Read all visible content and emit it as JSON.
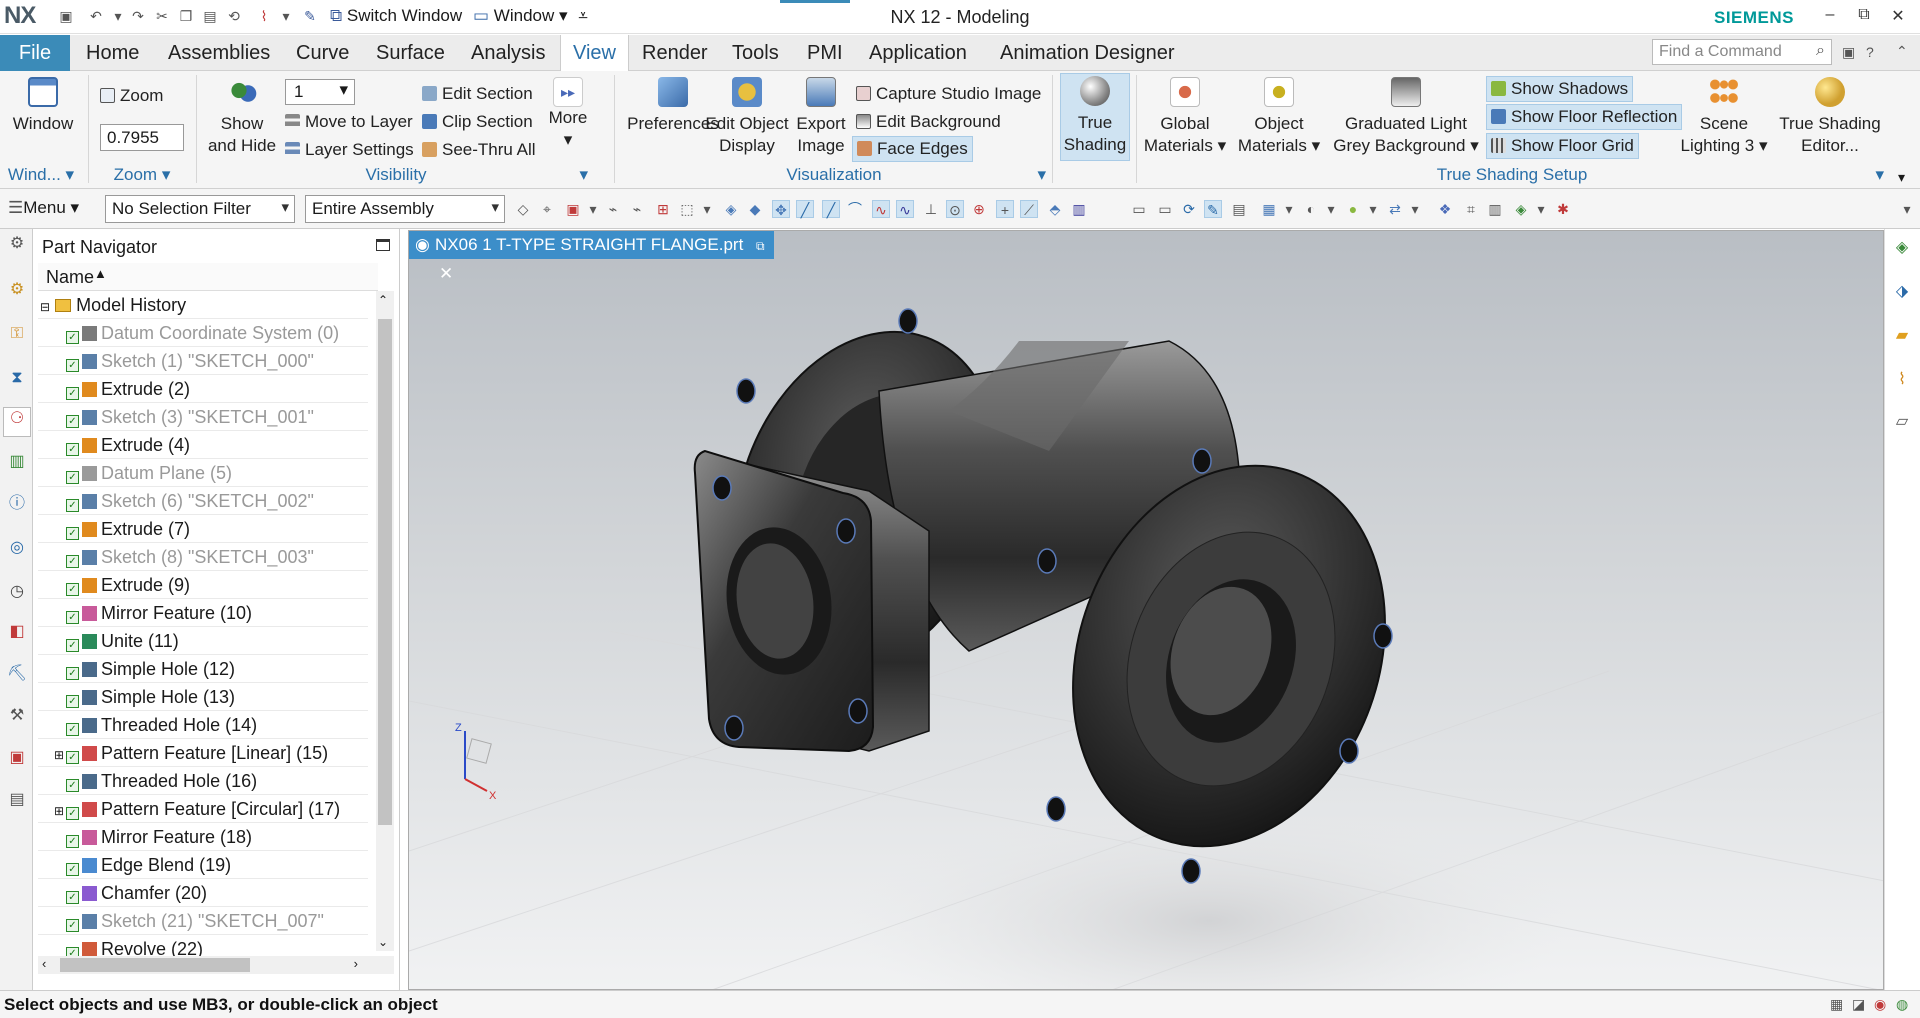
{
  "titlebar": {
    "logo": "NX",
    "switch_window": "Switch Window",
    "window": "Window",
    "title": "NX 12 - Modeling",
    "brand": "SIEMENS"
  },
  "menu": {
    "file": "File",
    "tabs": [
      "Home",
      "Assemblies",
      "Curve",
      "Surface",
      "Analysis",
      "View",
      "Render",
      "Tools",
      "PMI",
      "Application",
      "Animation Designer"
    ],
    "search_placeholder": "Find a Command"
  },
  "ribbon": {
    "window": "Window",
    "window_group": "Wind...",
    "zoom": "Zoom",
    "zoom_value": "0.7955",
    "zoom_group": "Zoom",
    "show_and_hide_1": "Show",
    "show_and_hide_2": "and Hide",
    "layer_value": "1",
    "move_to_layer": "Move to Layer",
    "layer_settings": "Layer Settings",
    "edit_section": "Edit Section",
    "clip_section": "Clip Section",
    "see_thru_all": "See-Thru All",
    "more": "More",
    "visibility_group": "Visibility",
    "preferences": "Preferences",
    "edit_object_display_1": "Edit Object",
    "edit_object_display_2": "Display",
    "export_image_1": "Export",
    "export_image_2": "Image",
    "capture_studio_image": "Capture Studio Image",
    "edit_background": "Edit Background",
    "face_edges": "Face Edges",
    "visualization_group": "Visualization",
    "true_shading_1": "True",
    "true_shading_2": "Shading",
    "global_materials_1": "Global",
    "global_materials_2": "Materials",
    "object_materials_1": "Object",
    "object_materials_2": "Materials",
    "graduated_light_1": "Graduated Light",
    "graduated_light_2": "Grey Background",
    "show_shadows": "Show Shadows",
    "show_floor_reflection": "Show Floor Reflection",
    "show_floor_grid": "Show Floor Grid",
    "scene_lighting_1": "Scene",
    "scene_lighting_2": "Lighting 3",
    "true_shading_editor_1": "True Shading",
    "true_shading_editor_2": "Editor...",
    "true_shading_setup_group": "True Shading Setup"
  },
  "toolbar": {
    "menu": "Menu",
    "selection_filter": "No Selection Filter",
    "scope": "Entire Assembly"
  },
  "navigator": {
    "title": "Part Navigator",
    "column_name": "Name",
    "root": "Model History",
    "items": [
      {
        "label": "Datum Coordinate System (0)",
        "grey": true,
        "icon": "#7a7a7a"
      },
      {
        "label": "Sketch (1) \"SKETCH_000\"",
        "grey": true,
        "icon": "#5a7fa8"
      },
      {
        "label": "Extrude (2)",
        "grey": false,
        "icon": "#e08a1e"
      },
      {
        "label": "Sketch (3) \"SKETCH_001\"",
        "grey": true,
        "icon": "#5a7fa8"
      },
      {
        "label": "Extrude (4)",
        "grey": false,
        "icon": "#e08a1e"
      },
      {
        "label": "Datum Plane (5)",
        "grey": true,
        "icon": "#9a9a9a"
      },
      {
        "label": "Sketch (6) \"SKETCH_002\"",
        "grey": true,
        "icon": "#5a7fa8"
      },
      {
        "label": "Extrude (7)",
        "grey": false,
        "icon": "#e08a1e"
      },
      {
        "label": "Sketch (8) \"SKETCH_003\"",
        "grey": true,
        "icon": "#5a7fa8"
      },
      {
        "label": "Extrude (9)",
        "grey": false,
        "icon": "#e08a1e"
      },
      {
        "label": "Mirror Feature (10)",
        "grey": false,
        "icon": "#c85a9a"
      },
      {
        "label": "Unite (11)",
        "grey": false,
        "icon": "#2a8a5a"
      },
      {
        "label": "Simple Hole (12)",
        "grey": false,
        "icon": "#4a6a8a"
      },
      {
        "label": "Simple Hole (13)",
        "grey": false,
        "icon": "#4a6a8a"
      },
      {
        "label": "Threaded Hole (14)",
        "grey": false,
        "icon": "#4a6a8a"
      },
      {
        "label": "Pattern Feature [Linear] (15)",
        "grey": false,
        "icon": "#d04a4a",
        "expand": true
      },
      {
        "label": "Threaded Hole (16)",
        "grey": false,
        "icon": "#4a6a8a"
      },
      {
        "label": "Pattern Feature [Circular] (17)",
        "grey": false,
        "icon": "#d04a4a",
        "expand": true
      },
      {
        "label": "Mirror Feature (18)",
        "grey": false,
        "icon": "#c85a9a"
      },
      {
        "label": "Edge Blend (19)",
        "grey": false,
        "icon": "#4a8ad0"
      },
      {
        "label": "Chamfer (20)",
        "grey": false,
        "icon": "#8a5ad0"
      },
      {
        "label": "Sketch (21) \"SKETCH_007\"",
        "grey": true,
        "icon": "#5a7fa8"
      },
      {
        "label": "Revolve (22)",
        "grey": false,
        "icon": "#d05a3a"
      }
    ]
  },
  "viewport": {
    "tab_title": "NX06 1 T-TYPE STRAIGHT FLANGE.prt",
    "axis_z": "Z",
    "axis_x": "X"
  },
  "status": {
    "message": "Select objects and use MB3, or double-click an object"
  }
}
